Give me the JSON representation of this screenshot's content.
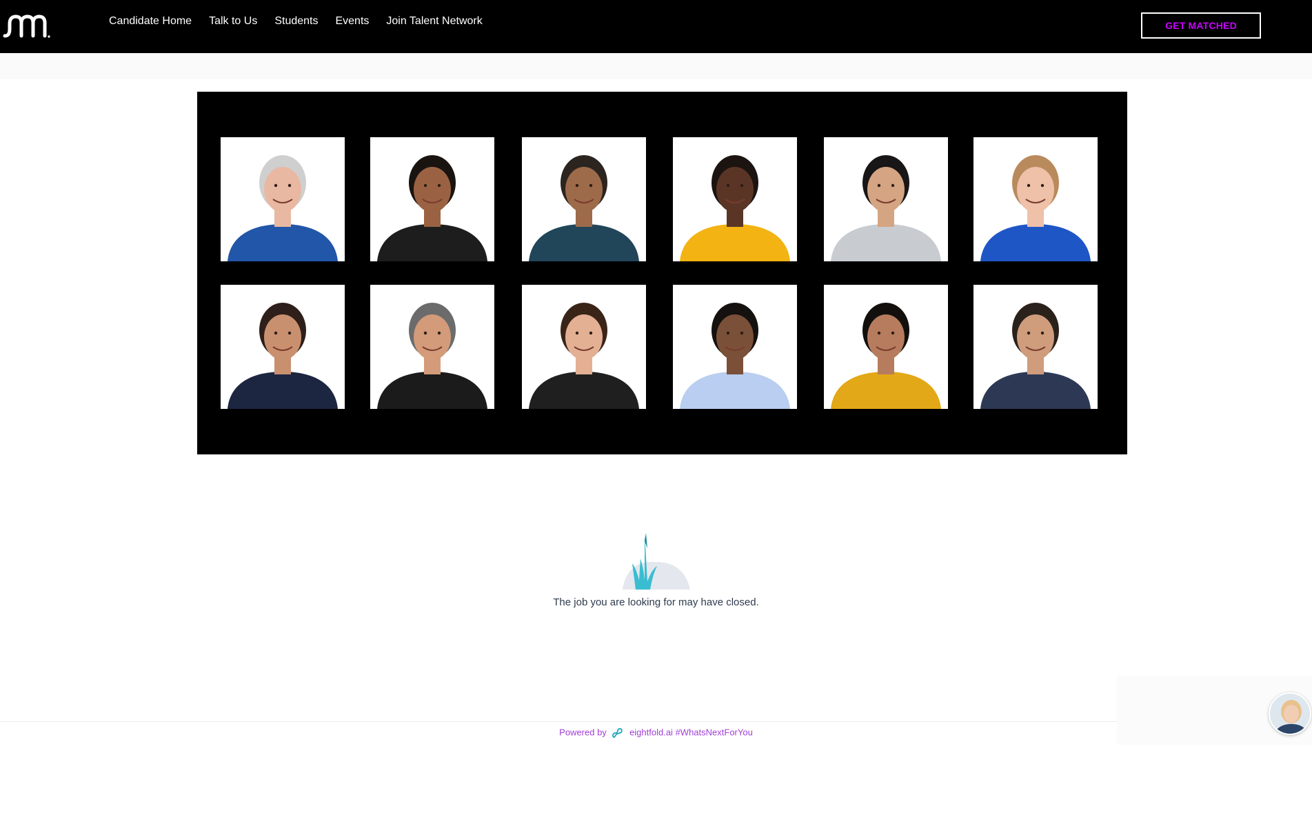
{
  "nav": {
    "items": [
      {
        "label": "Candidate Home"
      },
      {
        "label": "Talk to Us"
      },
      {
        "label": "Students"
      },
      {
        "label": "Events"
      },
      {
        "label": "Join Talent Network"
      }
    ],
    "cta_label": "GET MATCHED"
  },
  "colors": {
    "cta_text": "#c800ff",
    "powered_text": "#a13fd6",
    "hero_bg": "#000000"
  },
  "portraits": [
    {
      "shirt": "#2156a8",
      "skin": "#e9b8a2",
      "hair": "#cfcfcf"
    },
    {
      "shirt": "#1d1d1d",
      "skin": "#9a6243",
      "hair": "#1a1410"
    },
    {
      "shirt": "#214559",
      "skin": "#9d6a4a",
      "hair": "#2b241f"
    },
    {
      "shirt": "#f2b313",
      "skin": "#5a3526",
      "hair": "#1c1410"
    },
    {
      "shirt": "#c8ccd1",
      "skin": "#d4a483",
      "hair": "#181616"
    },
    {
      "shirt": "#1f56c6",
      "skin": "#eec1a8",
      "hair": "#b98a5c"
    },
    {
      "shirt": "#1d2640",
      "skin": "#c9906f",
      "hair": "#2e1f1a"
    },
    {
      "shirt": "#1b1b1b",
      "skin": "#d39b7a",
      "hair": "#6b6b6b"
    },
    {
      "shirt": "#1f1f1f",
      "skin": "#e3b094",
      "hair": "#3a2418"
    },
    {
      "shirt": "#b9cef0",
      "skin": "#7a5038",
      "hair": "#15110f"
    },
    {
      "shirt": "#e3a817",
      "skin": "#b67c5d",
      "hair": "#130f0d"
    },
    {
      "shirt": "#2d3954",
      "skin": "#cf9c7c",
      "hair": "#2a211b"
    }
  ],
  "empty_state": {
    "message": "The job you are looking for may have closed."
  },
  "footer": {
    "powered_by": "Powered by",
    "brand": "eightfold.ai",
    "hashtag": "#WhatsNextForYou"
  }
}
